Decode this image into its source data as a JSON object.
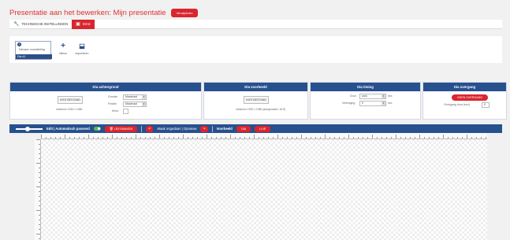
{
  "header": {
    "title": "Presentatie aan het bewerken: Mijn presentatie",
    "action_button": "Verwijderen"
  },
  "tabs": [
    {
      "label": "TECHNISCHE INSTELLINGEN",
      "icon": "wrench-icon",
      "active": false
    },
    {
      "label": "DIAS",
      "icon": "slides-icon",
      "active": true
    }
  ],
  "slides": {
    "card": {
      "number": "1",
      "name": "Nieuwe voorstelling",
      "selected_label": "Dia #1"
    },
    "tools": [
      {
        "label": "Nieuw",
        "icon": "plus-icon"
      },
      {
        "label": "Importeren",
        "icon": "import-icon"
      }
    ]
  },
  "panels": {
    "background": {
      "title": "Dia achtergrond",
      "choose": "KIES BESTAND",
      "note": "minimum 1920 x 1080",
      "opt1_label": "Grootte",
      "opt1_value": "Maximaal",
      "opt2_label": "Positie",
      "opt2_value": "Maximaal",
      "opt3_label": "Kleur"
    },
    "foreground": {
      "title": "Dia voorbeeld",
      "choose": "KIES BESTAND",
      "note": "minimum 1920 x 1080 (aangeraden: 16:9)"
    },
    "timing": {
      "title": "Dia timing",
      "field1_label": "Duur",
      "field1_value": "auto",
      "field1_unit": "sec",
      "field2_label": "Vertraging",
      "field2_value": "0",
      "field2_unit": "sec"
    },
    "transition": {
      "title": "Dia overgang",
      "button": "GEEN OVERGANG",
      "field_label": "Overgang duur (sec)",
      "field_value": "0"
    }
  },
  "editor": {
    "zoom_label": "Edit | Automatisch passend",
    "clear_button": "LEEGMAKEN",
    "undo_label": "Maak ongedaan | Opnieuw",
    "preview_label": "Voorbeeld",
    "preview_a": "DIA",
    "preview_b": "LIVE"
  },
  "colors": {
    "accent_red": "#d9262e",
    "navy": "#27508f"
  }
}
